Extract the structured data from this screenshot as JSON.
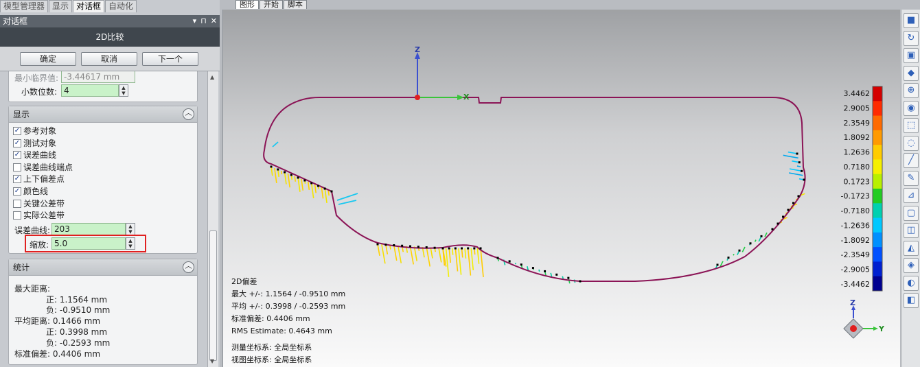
{
  "left_tabs": [
    "模型管理器",
    "显示",
    "对话框",
    "自动化"
  ],
  "dialog_bar": {
    "title": "对话框",
    "ctrl_dropdown": "▾",
    "ctrl_pin": "⊓",
    "ctrl_close": "✕"
  },
  "dialog": {
    "title": "2D比较",
    "ok_label": "确定",
    "cancel_label": "取消",
    "next_label": "下一个"
  },
  "params": {
    "min_threshold_label": "最小临界值:",
    "min_threshold_value": "-3.44617 mm",
    "decimals_label": "小数位数:",
    "decimals_value": "4"
  },
  "display": {
    "title": "显示",
    "options": [
      {
        "label": "参考对象",
        "checked": "✓"
      },
      {
        "label": "测试对象",
        "checked": "✓"
      },
      {
        "label": "误差曲线",
        "checked": "✓"
      },
      {
        "label": "误差曲线端点",
        "checked": ""
      },
      {
        "label": "上下偏差点",
        "checked": "✓"
      },
      {
        "label": "颜色线",
        "checked": "✓"
      },
      {
        "label": "关键公差带",
        "checked": ""
      },
      {
        "label": "实际公差带",
        "checked": ""
      }
    ],
    "error_curve_label": "误差曲线:",
    "error_curve_value": "203",
    "scale_label": "缩放:",
    "scale_value": "5.0"
  },
  "stats_panel": {
    "title": "统计",
    "lines": [
      "最大距离:",
      "正: 1.1564 mm",
      "负: -0.9510 mm",
      "平均距离: 0.1466 mm",
      "正: 0.3998 mm",
      "负: -0.2593 mm",
      "标准偏差: 0.4406 mm"
    ]
  },
  "view_tabs": [
    "图形",
    "开始",
    "脚本"
  ],
  "axes": {
    "z": "Z",
    "x": "X",
    "y": "Y"
  },
  "viewport_info": {
    "lines": [
      "2D偏差",
      "最大 +/-: 1.1564 / -0.9510 mm",
      "平均 +/-: 0.3998 / -0.2593 mm",
      "标准偏差: 0.4406 mm",
      "RMS Estimate: 0.4643 mm"
    ],
    "coord_lines": [
      "测量坐标系: 全局坐标系",
      "视图坐标系: 全局坐标系"
    ]
  },
  "color_scale": {
    "labels": [
      "3.4462",
      "2.9005",
      "2.3549",
      "1.8092",
      "1.2636",
      "0.7180",
      "0.1723",
      "-0.1723",
      "-0.7180",
      "-1.2636",
      "-1.8092",
      "-2.3549",
      "-2.9005",
      "-3.4462"
    ],
    "colors": [
      "#d40000",
      "#ff2a00",
      "#ff6a00",
      "#ff9a00",
      "#ffcc00",
      "#f5f000",
      "#b8f000",
      "#22cc22",
      "#00d0b0",
      "#00c8ff",
      "#0090ff",
      "#0050ff",
      "#0020d0",
      "#000090"
    ]
  },
  "toolbar_icons": [
    "cube-view-icon",
    "rotate-icon",
    "front-view-icon",
    "render-icon",
    "zoom-icon",
    "color-icon",
    "select-rect-icon",
    "select-lasso-icon",
    "line-icon",
    "measure-icon",
    "deviation-icon",
    "box-icon",
    "edge-icon",
    "triangle-icon",
    "feature-icon",
    "section-icon",
    "layer-icon"
  ],
  "toolbar_glyphs": [
    "■",
    "↻",
    "▣",
    "◆",
    "⊕",
    "◉",
    "⬚",
    "◌",
    "╱",
    "✎",
    "⊿",
    "▢",
    "◫",
    "◭",
    "◈",
    "◐",
    "◧"
  ]
}
